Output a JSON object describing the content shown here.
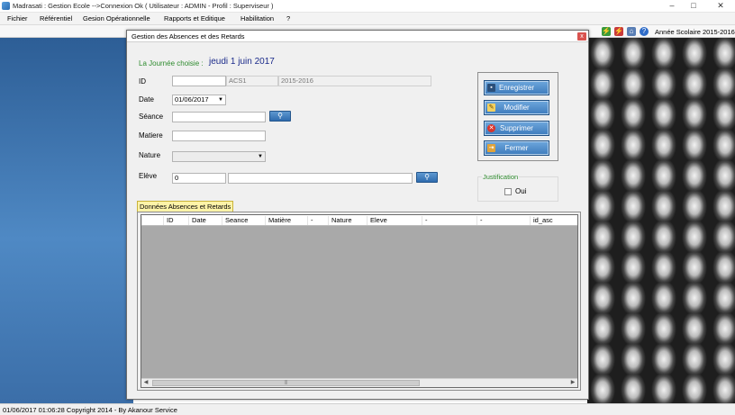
{
  "app": {
    "title": "Madrasati : Gestion Ecole -->Connexion Ok ( Utilisateur : ADMIN - Profil : Superviseur )",
    "window_buttons": [
      "–",
      "□",
      "✕"
    ]
  },
  "menu": [
    "Fichier",
    "Référentiel",
    "Gesion Opérationnelle",
    "Rapports et Editique",
    "Habilitation",
    "?"
  ],
  "toolbar": {
    "year_label": "Année Scolaire 2015-2016",
    "icons": [
      "plug-connect-icon",
      "plug-disconnect-icon",
      "home-icon",
      "help-icon"
    ]
  },
  "dialog": {
    "title": "Gestion des Absences et des Retards",
    "close_label": "x",
    "journee_label": "La Journée choisie :",
    "journee_value": "jeudi 1 juin 2017",
    "form": {
      "id_label": "ID",
      "id_value": "",
      "class_value": "ACS1",
      "year_value": "2015-2016",
      "date_label": "Date",
      "date_value": "01/06/2017",
      "seance_label": "Séance",
      "seance_value": "",
      "matiere_label": "Matiere",
      "matiere_value": "",
      "nature_label": "Nature",
      "nature_value": "",
      "eleve_label": "Elève",
      "eleve_id": "0",
      "eleve_name": ""
    },
    "actions": {
      "save": "Enregistrer",
      "edit": "Modifier",
      "delete": "Supprimer",
      "close": "Fermer"
    },
    "justification": {
      "legend": "Justification",
      "option": "Oui",
      "checked": false
    },
    "grid": {
      "tab_label": "Données Absences et Retards",
      "columns": [
        "ID",
        "Date",
        "Seance",
        "Matière",
        "-",
        "Nature",
        "Eleve",
        "-",
        "-",
        "id_asc"
      ],
      "rows": [],
      "scroll_grip": "|||"
    }
  },
  "status": {
    "text": "01/06/2017 01:06:28   Copyright 2014 - By Akanour Service"
  }
}
